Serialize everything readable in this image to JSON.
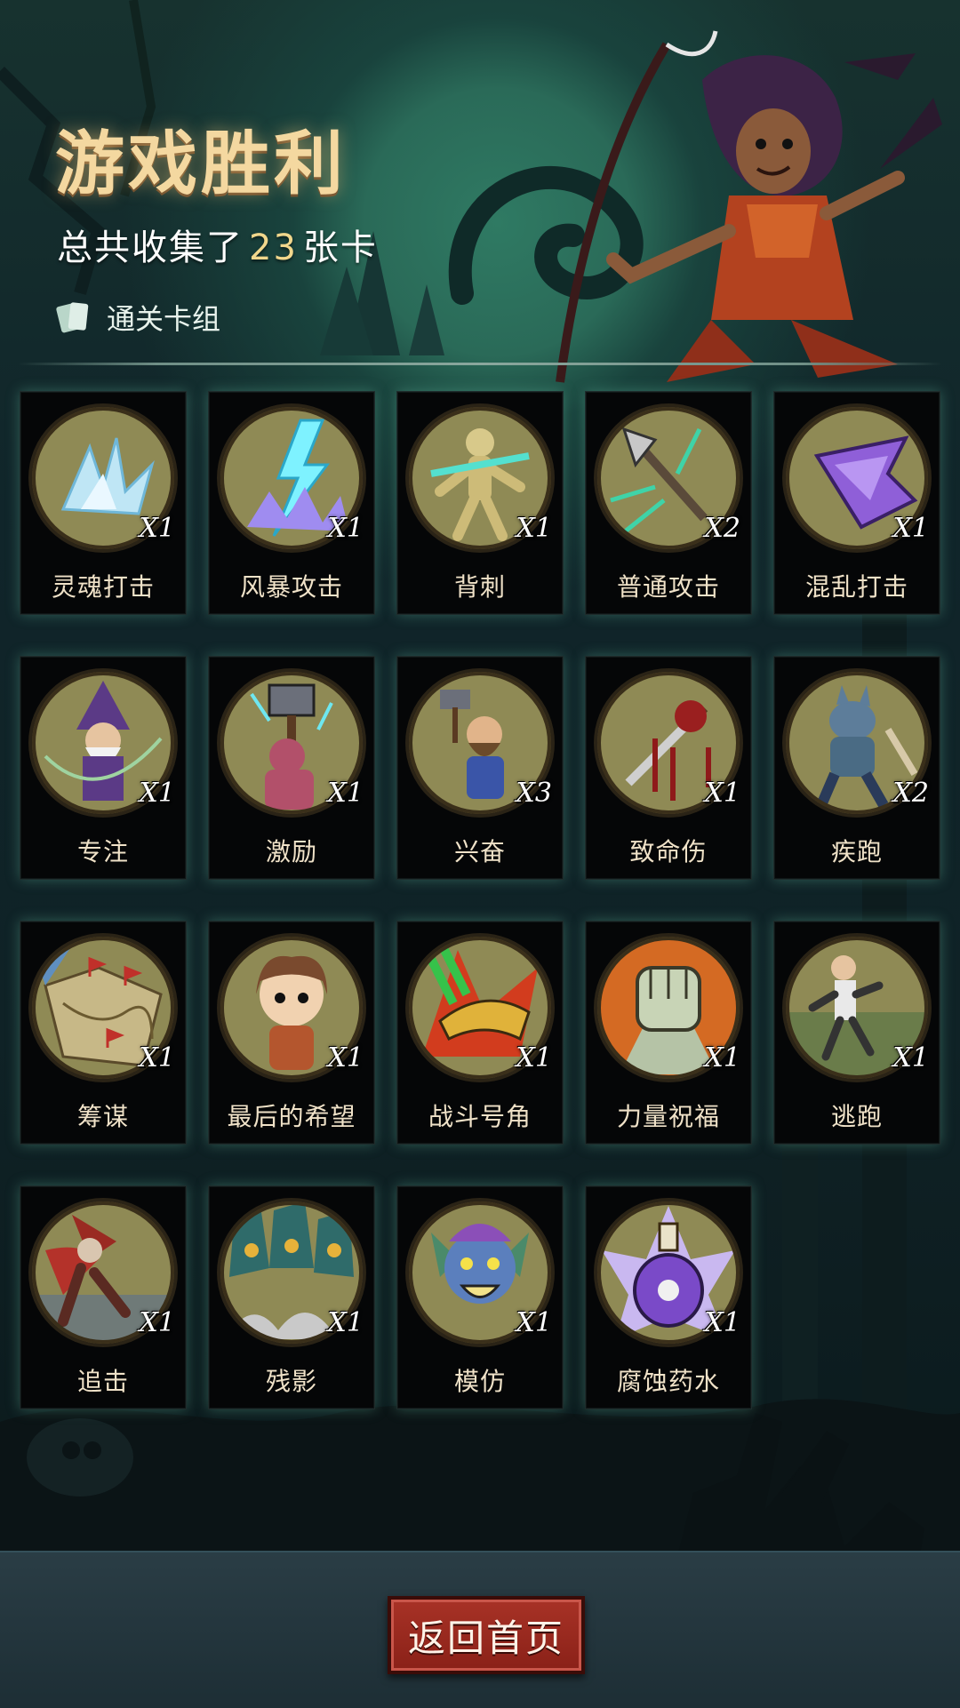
{
  "header": {
    "title": "游戏胜利",
    "summary_prefix": "总共收集了",
    "summary_count": "23",
    "summary_suffix": "张卡",
    "deck_link_label": "通关卡组"
  },
  "cards": [
    {
      "name": "灵魂打击",
      "qty": "X1",
      "art": "crystal"
    },
    {
      "name": "风暴攻击",
      "qty": "X1",
      "art": "lightning"
    },
    {
      "name": "背刺",
      "qty": "X1",
      "art": "mannequin"
    },
    {
      "name": "普通攻击",
      "qty": "X2",
      "art": "spear"
    },
    {
      "name": "混乱打击",
      "qty": "X1",
      "art": "purple-blade"
    },
    {
      "name": "专注",
      "qty": "X1",
      "art": "wizard"
    },
    {
      "name": "激励",
      "qty": "X1",
      "art": "hammer-brute"
    },
    {
      "name": "兴奋",
      "qty": "X3",
      "art": "dwarf"
    },
    {
      "name": "致命伤",
      "qty": "X1",
      "art": "bloody-knife"
    },
    {
      "name": "疾跑",
      "qty": "X2",
      "art": "werewolf"
    },
    {
      "name": "筹谋",
      "qty": "X1",
      "art": "map"
    },
    {
      "name": "最后的希望",
      "qty": "X1",
      "art": "girl"
    },
    {
      "name": "战斗号角",
      "qty": "X1",
      "art": "horn"
    },
    {
      "name": "力量祝福",
      "qty": "X1",
      "art": "fist"
    },
    {
      "name": "逃跑",
      "qty": "X1",
      "art": "running-man"
    },
    {
      "name": "追击",
      "qty": "X1",
      "art": "chaser"
    },
    {
      "name": "残影",
      "qty": "X1",
      "art": "hooded-group"
    },
    {
      "name": "模仿",
      "qty": "X1",
      "art": "goblin"
    },
    {
      "name": "腐蚀药水",
      "qty": "X1",
      "art": "potion"
    }
  ],
  "footer": {
    "home_button_label": "返回首页"
  },
  "colors": {
    "title": "#f4d8a0",
    "count_highlight": "#f1d78c",
    "button": "#a83226",
    "card_medallion": "#8f8a55"
  }
}
